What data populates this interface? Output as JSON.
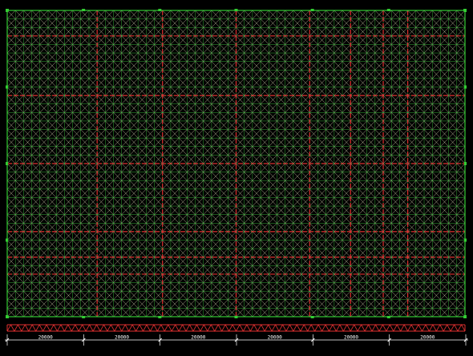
{
  "drawing": {
    "background": "#000000",
    "colors": {
      "grid_chord": "#3fbf3f",
      "grid_diagonal": "#f2f2c8",
      "primary_beam": "#e03030",
      "boundary": "#33cc33",
      "support_marker": "#33cc33",
      "dimension_line": "#ffffff",
      "truss": "#e03030"
    },
    "plan_grid": {
      "columns": 56,
      "rows": 36
    },
    "red_beams": {
      "vertical_at_columns": [
        11,
        19,
        28,
        37,
        42,
        46,
        49
      ],
      "horizontal_at_rows": [
        3,
        10,
        18,
        26,
        29,
        31
      ]
    },
    "supports": {
      "markers_per_long_side": 7,
      "markers_per_short_side": 5
    },
    "section_truss": {
      "zigzag_count": 64
    },
    "dimensions": {
      "bays": [
        {
          "label": "20000"
        },
        {
          "label": "20000"
        },
        {
          "label": "20000"
        },
        {
          "label": "20000"
        },
        {
          "label": "20000"
        },
        {
          "label": "20000"
        }
      ]
    }
  }
}
